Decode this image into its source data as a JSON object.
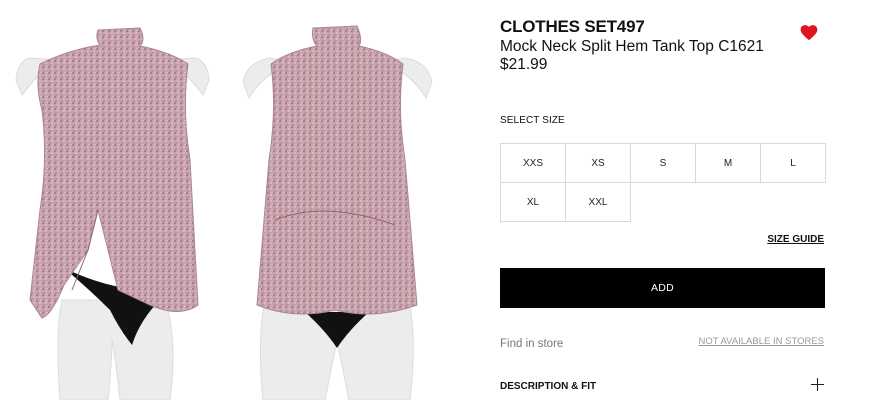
{
  "product": {
    "brand": "CLOTHES SET497",
    "name": "Mock Neck Split Hem Tank Top C1621",
    "price": "$21.99",
    "wishlist_icon": "heart-icon",
    "wishlist_color": "#e0161d"
  },
  "gallery": {
    "views": [
      "front",
      "back"
    ],
    "garment_color": "#c49aa5",
    "underwear_color": "#111111",
    "mannequin_color": "#ececec"
  },
  "size_section": {
    "label": "SELECT SIZE",
    "rows": [
      [
        "XXS",
        "XS",
        "S",
        "M",
        "L"
      ],
      [
        "XL",
        "XXL"
      ]
    ],
    "guide_link": "SIZE GUIDE"
  },
  "actions": {
    "add_label": "ADD",
    "find_store": "Find in store",
    "availability": "NOT AVAILABLE IN STORES"
  },
  "description": {
    "label": "DESCRIPTION & FIT",
    "expand_icon": "plus-icon"
  }
}
